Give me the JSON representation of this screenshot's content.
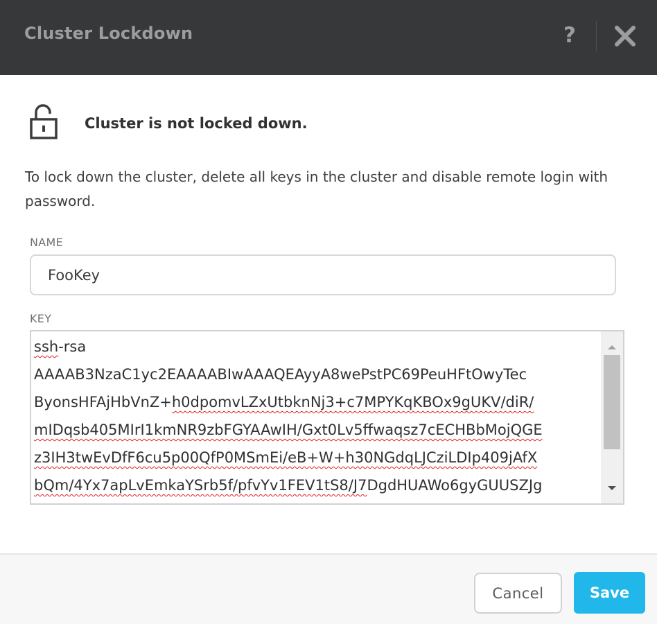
{
  "dialog": {
    "title": "Cluster Lockdown",
    "help_symbol": "?",
    "status_text": "Cluster is not locked down.",
    "description": "To lock down the cluster, delete all keys in the cluster and disable remote login with password."
  },
  "name_field": {
    "label": "NAME",
    "value": "FooKey"
  },
  "key_field": {
    "label": "KEY",
    "lines": [
      {
        "plain": "",
        "marked": "ssh",
        "rest": "-rsa"
      },
      {
        "plain": "AAAAB3NzaC1yc2EAAAABIwAAAQEAyyA8wePstPC69PeuHFtOwyTec",
        "marked": "",
        "rest": ""
      },
      {
        "plain": "ByonsHFAjHbVnZ+",
        "marked": "h0dpomvLZxUtbknNj3+c7MPYKqKBOx9gUKV/diR/",
        "rest": ""
      },
      {
        "plain": "",
        "marked": "mIDqsb405MIrI1kmNR9zbFGYAAwIH/Gxt0Lv5ffwaqsz7cECHBbMojQGE",
        "rest": ""
      },
      {
        "plain": "",
        "marked": "z3IH3twEvDfF6cu5p00QfP0MSmEi/eB+W+h30NGdqLJCziLDIp409jAfX",
        "rest": ""
      },
      {
        "plain": "",
        "marked": "bQm/4Yx7apLvEmkaYSrb5f/pfvYv1FEV1tS8/J7",
        "rest": "DgdHUAWo6gyGUUSZJg"
      }
    ]
  },
  "buttons": {
    "cancel": "Cancel",
    "save": "Save"
  },
  "colors": {
    "header_bg": "#36383a",
    "accent": "#22b7ea"
  }
}
